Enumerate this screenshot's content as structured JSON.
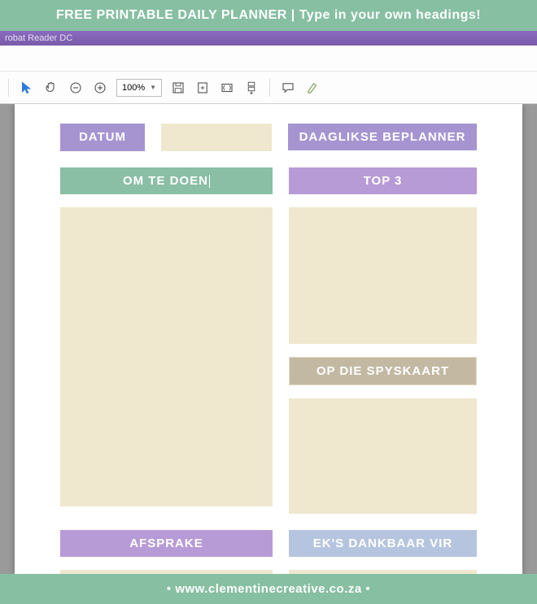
{
  "banner": {
    "text": "FREE PRINTABLE DAILY PLANNER | Type in your own headings!"
  },
  "app": {
    "title_fragment": "robat Reader DC"
  },
  "toolbar": {
    "zoom": "100%"
  },
  "planner": {
    "datum_label": "DATUM",
    "datum_value": "",
    "daaglikse": "DAAGLIKSE BEPLANNER",
    "om_te_doen": "OM TE DOEN",
    "top3": "TOP 3",
    "spyskaart": "OP DIE SPYSKAART",
    "afsprake": "AFSPRAKE",
    "dankbaar": "EK'S DANKBAAR VIR"
  },
  "footer": {
    "url": "www.clementinecreative.co.za"
  }
}
